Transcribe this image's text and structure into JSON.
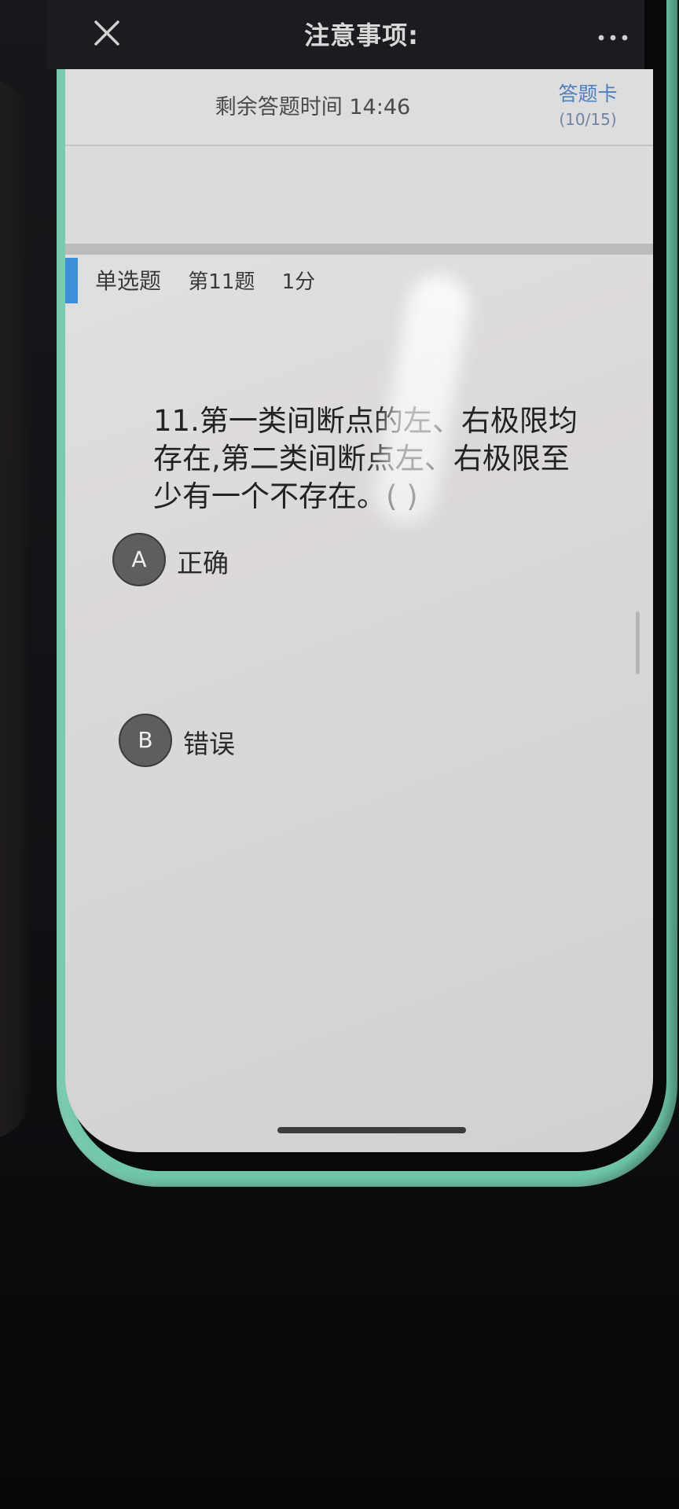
{
  "header": {
    "title": "注意事项:"
  },
  "exam": {
    "timer": "剩余答题时间 14:46",
    "answer_card_label": "答题卡",
    "answer_card_progress": "(10/15)"
  },
  "question": {
    "type": "单选题",
    "number": "第11题",
    "score": "1分",
    "text": "11.第一类间断点的左、右极限均存在,第二类间断点左、右极限至少有一个不存在。( )"
  },
  "options": [
    {
      "letter": "A",
      "text": "正确"
    },
    {
      "letter": "B",
      "text": "错误"
    }
  ],
  "colors": {
    "accent": "#3d8fd8",
    "phone_case": "#6fc8a8",
    "answer_card": "#4d7fbf"
  }
}
